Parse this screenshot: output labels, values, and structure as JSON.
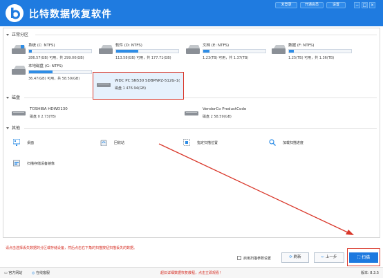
{
  "app": {
    "title": "比特数据恢复软件",
    "top_buttons": {
      "login": "未登录",
      "vip": "开通会员",
      "settings": "设置"
    },
    "window_controls": {
      "minimize": "−",
      "maximize": "□",
      "close": "×"
    },
    "brand_color": "#1f7be0"
  },
  "sections": {
    "partitions": "正常分区",
    "disks": "磁盘",
    "other": "其他"
  },
  "partitions": [
    {
      "name": "系统 (C: NTFS)",
      "size": "286.57(GB) 可用，共 299.00(GB)",
      "used": 0.04
    },
    {
      "name": "软件 (D: NTFS)",
      "size": "113.58(GB) 可用，共 177.71(GB)",
      "used": 0.36
    },
    {
      "name": "文档 (E: NTFS)",
      "size": "1.23(TB) 可用，共 1.37(TB)",
      "used": 0.1
    },
    {
      "name": "数据 (F: NTFS)",
      "size": "1.25(TB) 可用，共 1.36(TB)",
      "used": 0.08
    },
    {
      "name": "本地磁盘 (G: NTFS)",
      "size": "36.47(GB) 可用，共 58.59(GB)",
      "used": 0.38
    }
  ],
  "disks": [
    {
      "name": "TOSHIBA HDWD130",
      "info": "磁盘 0    2.73(TB)"
    },
    {
      "name": "WDC PC SN530 SDBPNPZ-512G-1(",
      "info": "磁盘 1    476.94(GB)"
    },
    {
      "name": "VendorCo ProductCode",
      "info": "磁盘 2    58.59(GB)"
    }
  ],
  "other_items": [
    {
      "label": "桌面",
      "icon": "desktop-icon"
    },
    {
      "label": "回收站",
      "icon": "recycle-bin-icon"
    },
    {
      "label": "指定扫描位置",
      "icon": "location-icon"
    },
    {
      "label": "加载扫描进度",
      "icon": "search-icon"
    },
    {
      "label": "扫描存储设备镜像",
      "icon": "disk-image-icon"
    }
  ],
  "bottom": {
    "hint": "请点击选择丢失数据的分区或存储设备，然后点击右下角的扫描按钮扫描丢失的数据。",
    "checkbox_label": "启用扫描参数设置",
    "refresh": "刷新",
    "prev": "上一步",
    "scan": "扫描"
  },
  "statusbar": {
    "website": "官方网站",
    "support": "在线客服",
    "promo": "超旧详细数据恢复教程，点击立即观看！",
    "version": "版本: 8.3.5"
  },
  "colors": {
    "accent": "#1f7be0",
    "highlight": "#d9372a",
    "bar_fill": "#2e8de6"
  }
}
